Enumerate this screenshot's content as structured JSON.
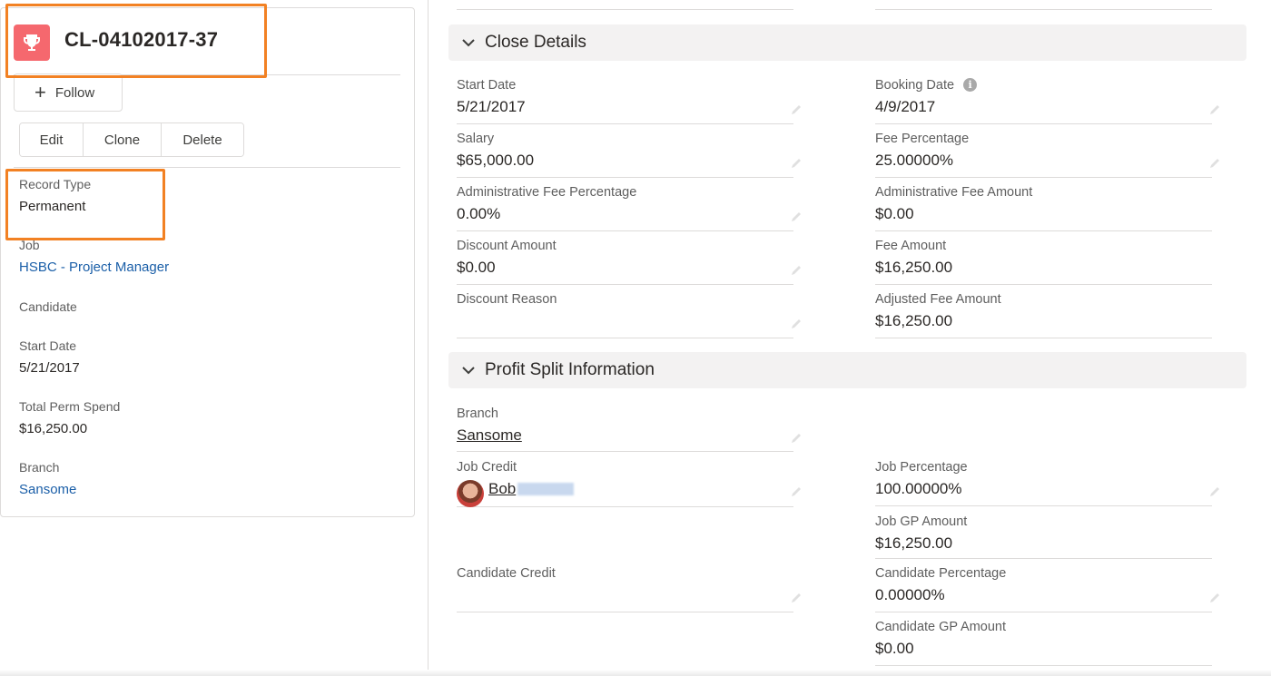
{
  "record": {
    "title": "CL-04102017-37",
    "icon": "trophy-icon",
    "icon_color": "#f5686e"
  },
  "actions": {
    "follow": "Follow",
    "edit": "Edit",
    "clone": "Clone",
    "delete": "Delete"
  },
  "highlights": {
    "color": "#f28123"
  },
  "left_fields": [
    {
      "label": "Record Type",
      "value": "Permanent"
    },
    {
      "label": "Job",
      "value": "HSBC - Project Manager"
    },
    {
      "label": "Candidate",
      "value": ""
    },
    {
      "label": "Start Date",
      "value": "5/21/2017"
    },
    {
      "label": "Total Perm Spend",
      "value": "$16,250.00"
    },
    {
      "label": "Branch",
      "value": "Sansome"
    }
  ],
  "close_details": {
    "title": "Close Details",
    "left": [
      {
        "label": "Start Date",
        "value": "5/21/2017"
      },
      {
        "label": "Salary",
        "value": "$65,000.00"
      },
      {
        "label": "Administrative Fee Percentage",
        "value": "0.00%"
      },
      {
        "label": "Discount Amount",
        "value": "$0.00"
      },
      {
        "label": "Discount Reason",
        "value": ""
      }
    ],
    "right": [
      {
        "label": "Booking Date",
        "value": "4/9/2017"
      },
      {
        "label": "Fee Percentage",
        "value": "25.00000%"
      },
      {
        "label": "Administrative Fee Amount",
        "value": "$0.00"
      },
      {
        "label": "Fee Amount",
        "value": "$16,250.00"
      },
      {
        "label": "Adjusted Fee Amount",
        "value": "$16,250.00"
      }
    ]
  },
  "profit_split": {
    "title": "Profit Split Information",
    "left": [
      {
        "label": "Branch",
        "value": "Sansome"
      },
      {
        "label": "Job Credit",
        "value": "Bob"
      },
      {
        "label": "Candidate Credit",
        "value": ""
      }
    ],
    "right": [
      {
        "label": "Job Percentage",
        "value": "100.00000%"
      },
      {
        "label": "Job GP Amount",
        "value": "$16,250.00"
      },
      {
        "label": "Candidate Percentage",
        "value": "0.00000%"
      },
      {
        "label": "Candidate GP Amount",
        "value": "$0.00"
      }
    ]
  }
}
